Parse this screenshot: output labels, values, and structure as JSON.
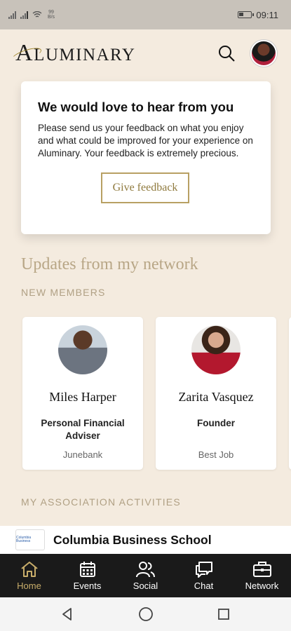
{
  "status_bar": {
    "net_speed": "99 B/s",
    "time": "09:11",
    "battery_level": 0.4
  },
  "header": {
    "logo_initial": "A",
    "logo_rest": "LUMINARY"
  },
  "feedback": {
    "title": "We would love to hear from you",
    "body": "Please send us your feedback on what you enjoy and what could be improved for your experience on Aluminary. Your feedback is extremely precious.",
    "button_label": "Give feedback"
  },
  "updates": {
    "title": "Updates from my network",
    "new_members_label": "NEW MEMBERS",
    "members": [
      {
        "name": "Miles Harper",
        "role": "Personal Financial Adviser",
        "company": "Junebank"
      },
      {
        "name": "Zarita Vasquez",
        "role": "Founder",
        "company": "Best Job"
      }
    ]
  },
  "association": {
    "label": "MY ASSOCIATION ACTIVITIES",
    "school_logo_text": "Columbia Business",
    "school_name": "Columbia Business School"
  },
  "bottom_nav": {
    "items": [
      {
        "label": "Home",
        "icon": "home-icon",
        "active": true
      },
      {
        "label": "Events",
        "icon": "calendar-icon",
        "active": false
      },
      {
        "label": "Social",
        "icon": "people-icon",
        "active": false
      },
      {
        "label": "Chat",
        "icon": "chat-icon",
        "active": false
      },
      {
        "label": "Network",
        "icon": "briefcase-icon",
        "active": false
      }
    ]
  },
  "colors": {
    "background": "#f4ebdf",
    "accent_gold": "#b8a063",
    "nav_bg": "#1a1a1a",
    "nav_active": "#c8ad6a"
  }
}
